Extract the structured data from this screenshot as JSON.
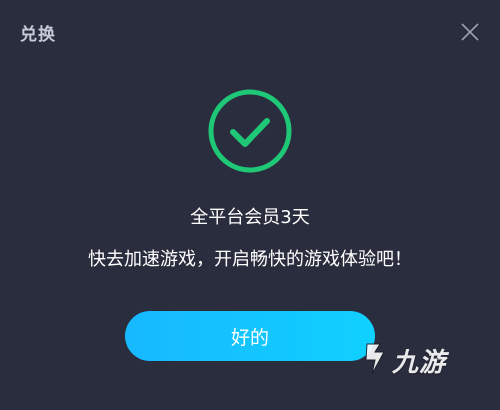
{
  "dialog": {
    "title": "兑换",
    "close_icon": "close-icon",
    "success_icon": "check-circle-icon",
    "message_title": "全平台会员3天",
    "message_body": "快去加速游戏，开启畅快的游戏体验吧！",
    "ok_label": "好的"
  },
  "watermark": {
    "text": "九游",
    "icon": "jiuyou-logo-icon"
  },
  "colors": {
    "background": "#2a2d3e",
    "success": "#1fc877",
    "button": "#10c9ff",
    "title": "#c7cbd8"
  }
}
